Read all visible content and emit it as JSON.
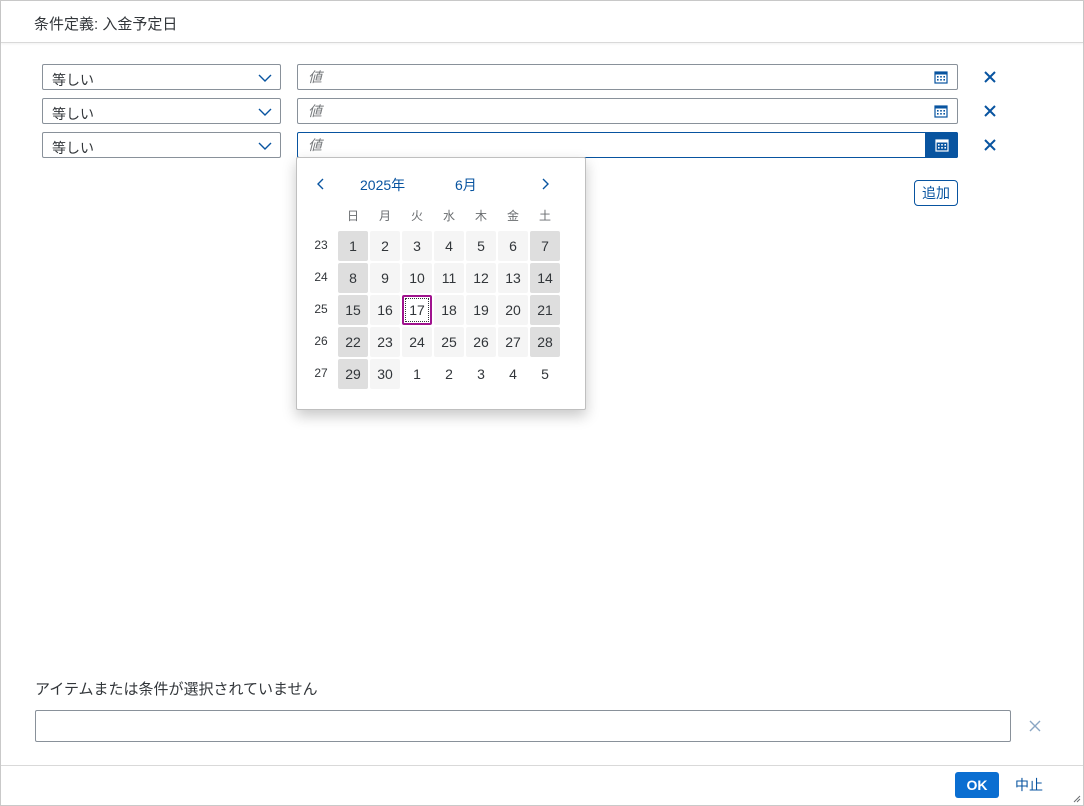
{
  "dialog": {
    "title": "条件定義: 入金予定日"
  },
  "conditions": [
    {
      "operator": "等しい",
      "placeholder": "値",
      "value": ""
    },
    {
      "operator": "等しい",
      "placeholder": "値",
      "value": ""
    },
    {
      "operator": "等しい",
      "placeholder": "値",
      "value": ""
    }
  ],
  "add_label": "追加",
  "calendar": {
    "year": "2025年",
    "month": "6月",
    "weekdays": [
      "日",
      "月",
      "火",
      "水",
      "木",
      "金",
      "土"
    ],
    "weeks": [
      {
        "number": "23",
        "days": [
          "1",
          "2",
          "3",
          "4",
          "5",
          "6",
          "7"
        ]
      },
      {
        "number": "24",
        "days": [
          "8",
          "9",
          "10",
          "11",
          "12",
          "13",
          "14"
        ]
      },
      {
        "number": "25",
        "days": [
          "15",
          "16",
          "17",
          "18",
          "19",
          "20",
          "21"
        ]
      },
      {
        "number": "26",
        "days": [
          "22",
          "23",
          "24",
          "25",
          "26",
          "27",
          "28"
        ]
      },
      {
        "number": "27",
        "days": [
          "29",
          "30",
          "1",
          "2",
          "3",
          "4",
          "5"
        ]
      }
    ],
    "today": "17"
  },
  "tokens": {
    "empty_text": "アイテムまたは条件が選択されていません",
    "value": ""
  },
  "footer": {
    "ok_label": "OK",
    "cancel_label": "中止"
  },
  "colors": {
    "accent": "#0854a0",
    "ok_bg": "#0a6ed1",
    "today_border": "#a0138e",
    "weekend_bg": "#dedede",
    "weekday_bg": "#f5f5f5"
  },
  "icons": {
    "dropdown": "chevron-down-icon",
    "calendar": "calendar-icon",
    "remove": "close-icon",
    "prev": "chevron-left-icon",
    "next": "chevron-right-icon"
  }
}
